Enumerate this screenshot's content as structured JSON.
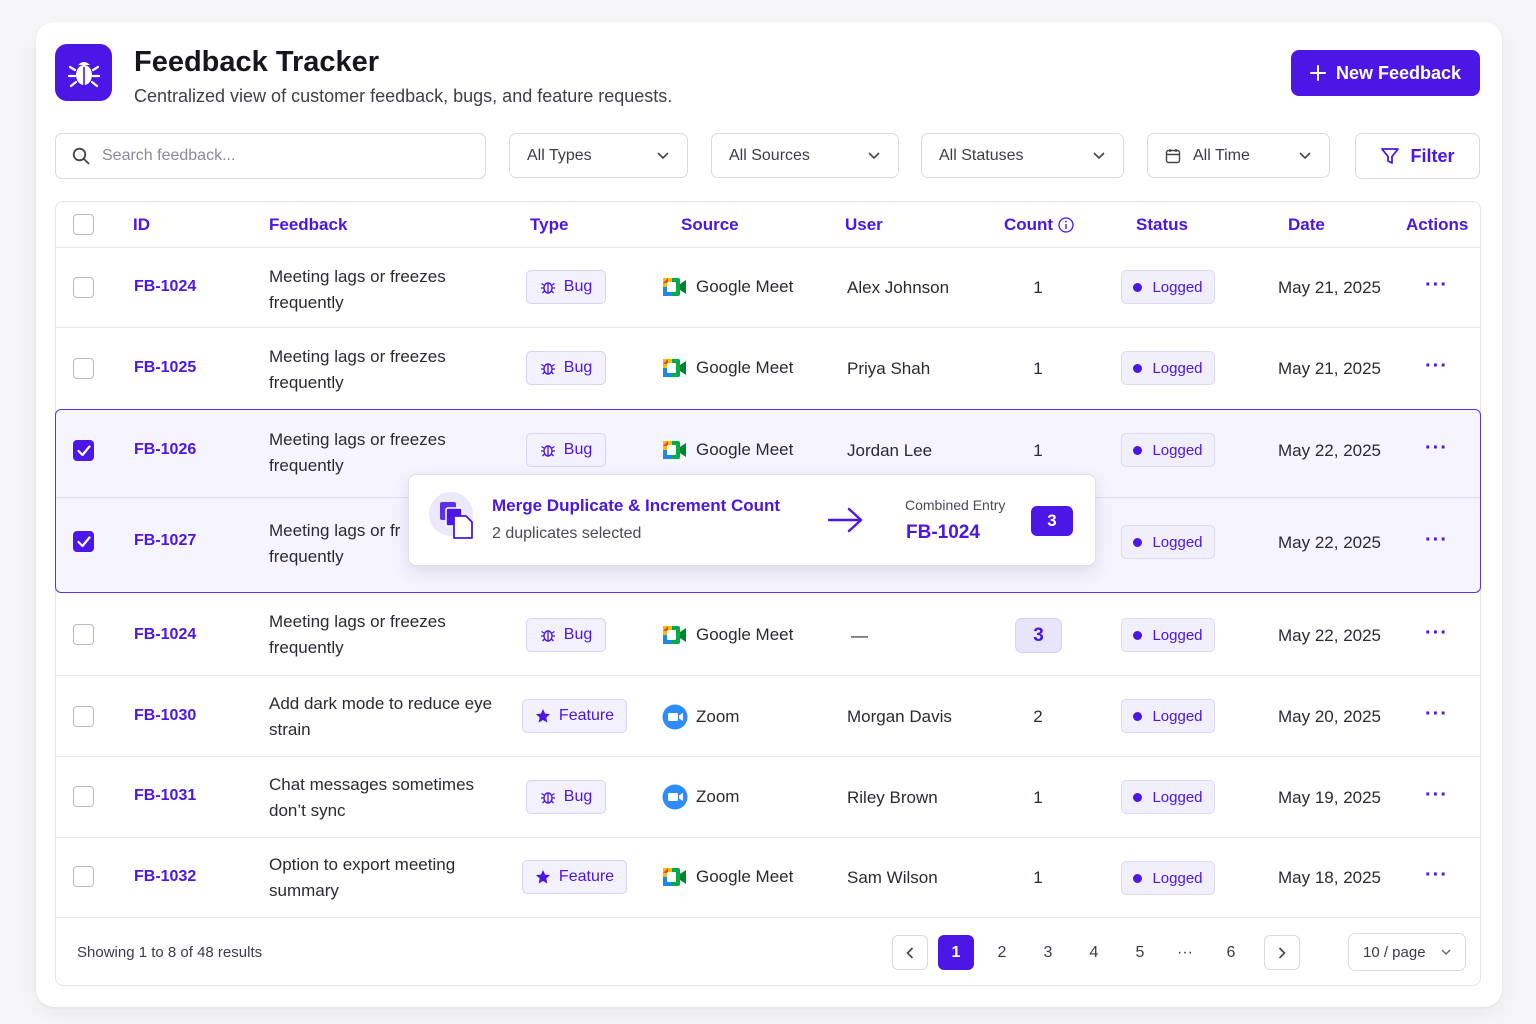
{
  "app": {
    "title": "Feedback Tracker",
    "subtitle": "Centralized view of customer feedback, bugs, and feature requests.",
    "new_button": "New Feedback",
    "accent": "#4b16e6"
  },
  "filters": {
    "search_placeholder": "Search feedback...",
    "types": "All Types",
    "sources": "All Sources",
    "statuses": "All Statuses",
    "time": "All Time",
    "filter_button": "Filter"
  },
  "table": {
    "columns": {
      "id": "ID",
      "feedback": "Feedback",
      "type": "Type",
      "source": "Source",
      "user": "User",
      "count": "Count",
      "status": "Status",
      "date": "Date",
      "actions": "Actions"
    },
    "rows": [
      {
        "id": "FB-1024",
        "feedback": "Meeting lags or freezes frequently",
        "type": "Bug",
        "type_icon": "bug-icon",
        "source": "Google Meet",
        "source_icon": "google-meet-icon",
        "user": "Alex Johnson",
        "count": "1",
        "status": "Logged",
        "date": "May 21, 2025",
        "checked": false
      },
      {
        "id": "FB-1025",
        "feedback": "Meeting lags or freezes frequently",
        "type": "Bug",
        "type_icon": "bug-icon",
        "source": "Google Meet",
        "source_icon": "google-meet-icon",
        "user": "Priya Shah",
        "count": "1",
        "status": "Logged",
        "date": "May 21, 2025",
        "checked": false
      },
      {
        "id": "FB-1026",
        "feedback": "Meeting lags or freezes frequently",
        "type": "Bug",
        "type_icon": "bug-icon",
        "source": "Google Meet",
        "source_icon": "google-meet-icon",
        "user": "Jordan Lee",
        "count": "1",
        "status": "Logged",
        "date": "May 22, 2025",
        "checked": true
      },
      {
        "id": "FB-1027",
        "feedback": "Meeting lags or fr",
        "feedback_line2": "frequently",
        "status": "Logged",
        "date": "May 22, 2025",
        "checked": true
      },
      {
        "id": "FB-1024",
        "feedback": "Meeting lags or freezes frequently",
        "type": "Bug",
        "type_icon": "bug-icon",
        "source": "Google Meet",
        "source_icon": "google-meet-icon",
        "user": "—",
        "count": "3",
        "status": "Logged",
        "date": "May 22, 2025",
        "checked": false
      },
      {
        "id": "FB-1030",
        "feedback": "Add dark mode to reduce eye strain",
        "type": "Feature",
        "type_icon": "star-icon",
        "source": "Zoom",
        "source_icon": "zoom-icon",
        "user": "Morgan Davis",
        "count": "2",
        "status": "Logged",
        "date": "May 20, 2025",
        "checked": false
      },
      {
        "id": "FB-1031",
        "feedback": "Chat messages sometimes don’t sync",
        "type": "Bug",
        "type_icon": "bug-icon",
        "source": "Zoom",
        "source_icon": "zoom-icon",
        "user": "Riley Brown",
        "count": "1",
        "status": "Logged",
        "date": "May 19, 2025",
        "checked": false
      },
      {
        "id": "FB-1032",
        "feedback": "Option to export meeting summary",
        "type": "Feature",
        "type_icon": "star-icon",
        "source": "Google Meet",
        "source_icon": "google-meet-icon",
        "user": "Sam Wilson",
        "count": "1",
        "status": "Logged",
        "date": "May 18, 2025",
        "checked": false
      }
    ]
  },
  "merge_popup": {
    "title": "Merge Duplicate & Increment Count",
    "subtitle": "2 duplicates selected",
    "combined_label": "Combined Entry",
    "combined_id": "FB-1024",
    "combined_count": "3"
  },
  "footer": {
    "showing": "Showing 1 to 8 of 48 results",
    "pages": [
      "1",
      "2",
      "3",
      "4",
      "5",
      "···",
      "6"
    ],
    "active_page": "1",
    "per_page": "10 / page"
  }
}
